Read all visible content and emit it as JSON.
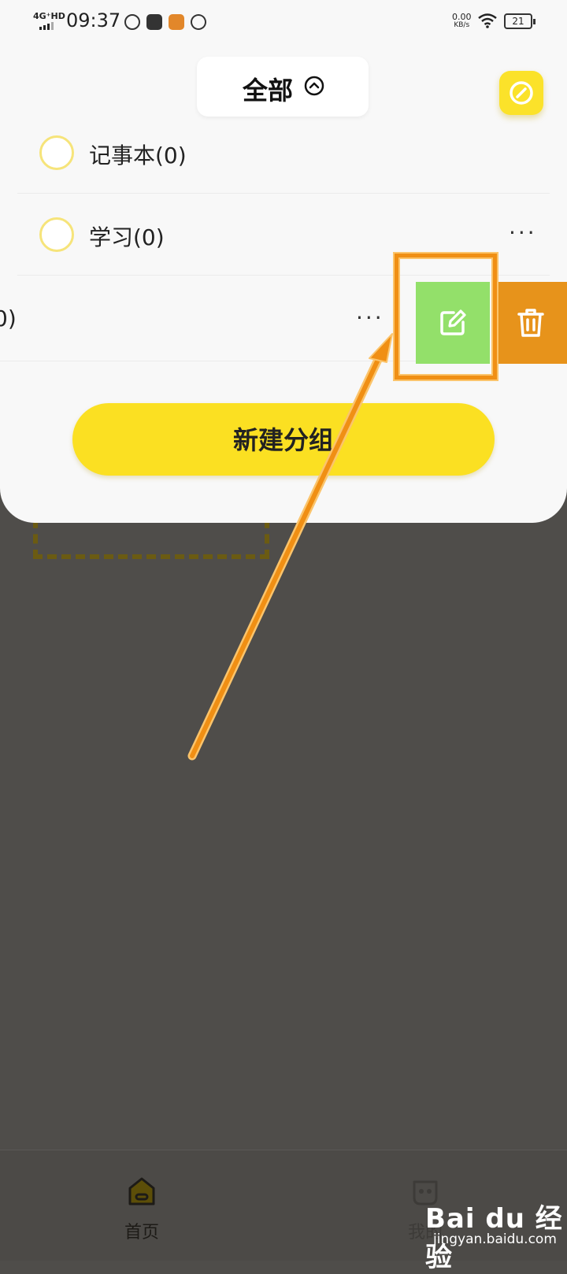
{
  "status_bar": {
    "network": "4G⁺HD",
    "time": "09:37",
    "speed_value": "0.00",
    "speed_unit": "KB/s",
    "battery": "21"
  },
  "header": {
    "title": "全部",
    "title_chevron_icon": "chevron-up-circle-icon",
    "edit_icon": "edit-icon"
  },
  "groups": [
    {
      "label": "记事本(0)"
    },
    {
      "label": "学习(0)"
    },
    {
      "label": "0)"
    }
  ],
  "swipe_actions": {
    "edit_icon": "edit-icon",
    "edit_color": "#93e06a",
    "delete_icon": "trash-icon",
    "delete_color": "#e7931b"
  },
  "new_group_button": "新建分组",
  "bottom_nav": [
    {
      "label": "首页",
      "icon": "home-icon"
    },
    {
      "label": "我的",
      "icon": "profile-icon"
    }
  ],
  "watermark": {
    "logo": "Bai du 经验",
    "url": "jingyan.baidu.com"
  },
  "colors": {
    "accent_yellow": "#fbe022",
    "annotation_orange": "#f08f14"
  }
}
